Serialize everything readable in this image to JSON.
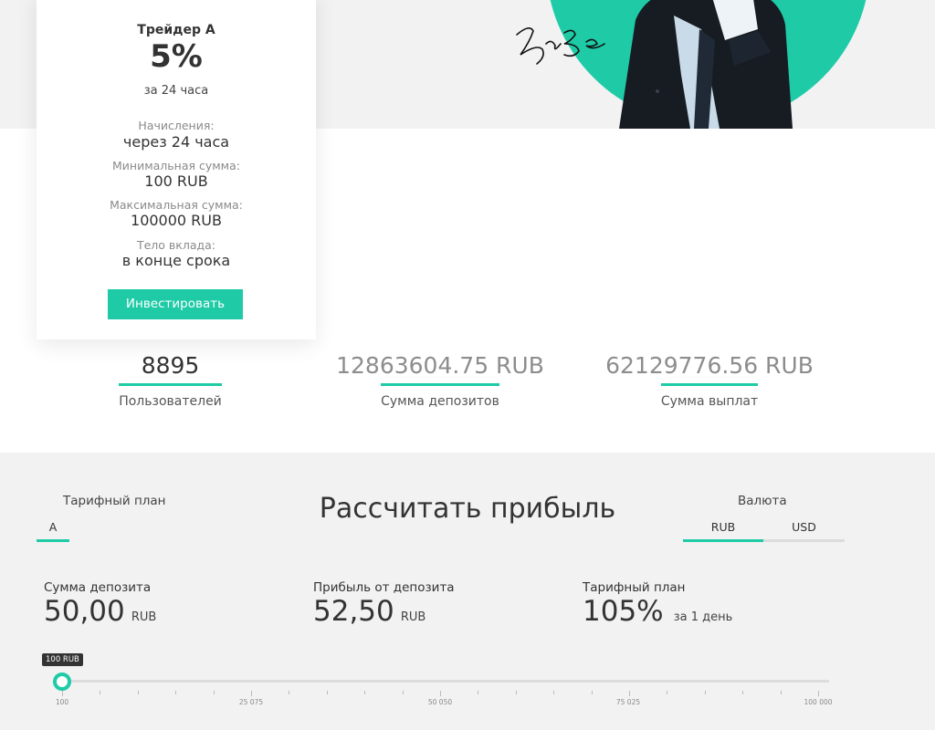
{
  "plan_card": {
    "name": "Трейдер A",
    "percent": "5%",
    "period": "за 24 часа",
    "fields": [
      {
        "label": "Начисления:",
        "value": "через 24 часа"
      },
      {
        "label": "Минимальная сумма:",
        "value": "100 RUB"
      },
      {
        "label": "Максимальная сумма:",
        "value": "100000 RUB"
      },
      {
        "label": "Тело вклада:",
        "value": "в конце срока"
      }
    ],
    "button_label": "Инвестировать"
  },
  "stats": [
    {
      "value": "8895",
      "label": "Пользователей"
    },
    {
      "value": "12863604.75 RUB",
      "label": "Сумма депозитов"
    },
    {
      "value": "62129776.56 RUB",
      "label": "Сумма выплат"
    }
  ],
  "calculator": {
    "title": "Рассчитать прибыль",
    "plan_label": "Тарифный план",
    "plan_value": "A",
    "currency_label": "Валюта",
    "currencies": [
      "RUB",
      "USD"
    ],
    "active_currency": "RUB",
    "deposit_label": "Сумма депозита",
    "deposit_value": "50,00",
    "deposit_unit": "RUB",
    "profit_label": "Прибыль от депозита",
    "profit_value": "52,50",
    "profit_unit": "RUB",
    "rate_label": "Тарифный план",
    "rate_value": "105%",
    "rate_period": "за 1 день",
    "slider": {
      "tooltip": "100 RUB",
      "tick_labels": [
        "100",
        "25 075",
        "50 050",
        "75 025",
        "100 000"
      ],
      "position_fraction": 0
    }
  },
  "colors": {
    "accent": "#1ecba6",
    "band_background": "#f2f2f3"
  }
}
